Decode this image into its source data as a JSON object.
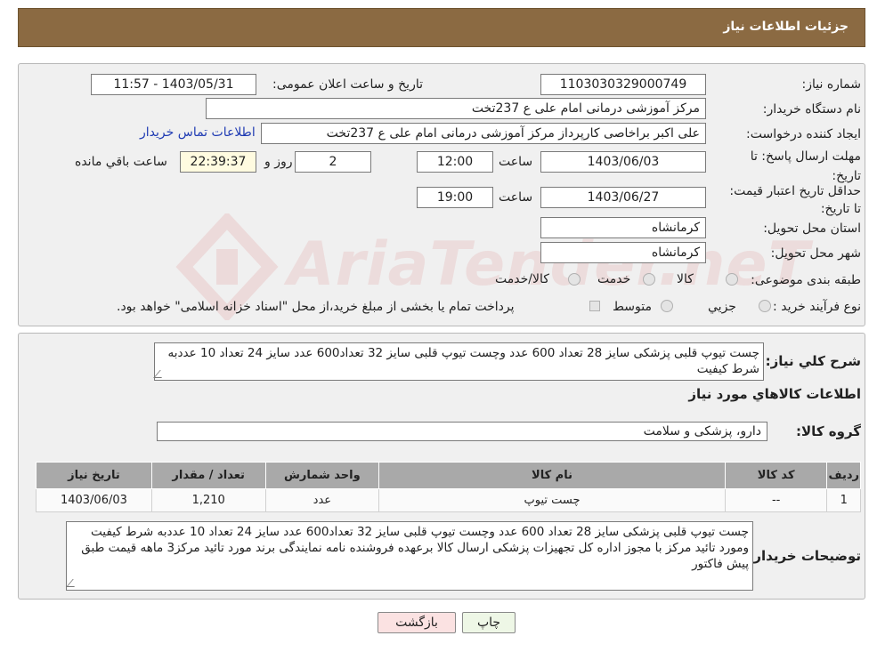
{
  "header": {
    "title": "جزئیات اطلاعات نیاز"
  },
  "form": {
    "need_number_label": "شماره نیاز:",
    "need_number": "1103030329000749",
    "announce_datetime_label": "تاریخ و ساعت اعلان عمومی:",
    "announce_datetime": "1403/05/31 - 11:57",
    "buyer_org_label": "نام دستگاه خریدار:",
    "buyer_org": "مرکز آموزشی درمانی امام علی ع 237تخت",
    "requester_label": "ایجاد کننده درخواست:",
    "requester": "علی اکبر براخاصی کارپرداز  مرکز آموزشی درمانی امام علی ع 237تخت",
    "contact_link": "اطلاعات تماس خریدار",
    "reply_deadline_label": "مهلت ارسال پاسخ: تا تاریخ:",
    "reply_deadline_date": "1403/06/03",
    "time_label": "ساعت",
    "reply_deadline_time": "12:00",
    "days_count": "2",
    "days_label": "روز و",
    "remaining_time": "22:39:37",
    "remaining_label": "ساعت باقي مانده",
    "price_validity_label": "حداقل تاریخ اعتبار قیمت: تا تاریخ:",
    "price_validity_date": "1403/06/27",
    "price_validity_time": "19:00",
    "province_label": "استان محل تحویل:",
    "province": "کرمانشاه",
    "city_label": "شهر محل تحویل:",
    "city": "کرمانشاه",
    "category_label": "طبقه بندی موضوعی:",
    "category_options": [
      "کالا",
      "خدمت",
      "کالا/خدمت"
    ],
    "purchase_type_label": "نوع فرآیند خرید :",
    "purchase_options": [
      "جزیي",
      "متوسط"
    ],
    "payment_note": "پرداخت تمام یا بخشی از مبلغ خرید،از محل \"اسناد خزانه اسلامی\" خواهد بود."
  },
  "summary": {
    "label": "شرح كلي نياز:",
    "text": "چست تیوپ  قلبی پزشکی سایز 28  تعداد 600 عدد وچست تیوپ  قلبی سایز 32 تعداد600 عدد سایز  24 تعداد 10 عددبه شرط کیفیت",
    "items_title": "اطلاعات كالاهاي مورد نياز",
    "group_label": "گروه کالا:",
    "group_value": "دارو، پزشکی و سلامت"
  },
  "table": {
    "columns": [
      "رديف",
      "کد کالا",
      "نام کالا",
      "واحد شمارش",
      "تعداد / مقدار",
      "تاریخ نیاز"
    ],
    "rows": [
      [
        "1",
        "--",
        "چست تیوپ",
        "عدد",
        "1,210",
        "1403/06/03"
      ]
    ]
  },
  "buyer_notes": {
    "label": "توضیحات خریدار:",
    "text": "چست تیوپ  قلبی پزشکی سایز 28  تعداد 600 عدد وچست تیوپ  قلبی سایز 32 تعداد600 عدد سایز  24 تعداد 10 عددبه شرط کیفیت ومورد تائید مرکز با مجوز اداره کل تجهیزات پزشکی ارسال کالا برعهده فروشنده نامه نمایندگی برند مورد تائید مرکز3 ماهه قیمت طبق پیش فاکتور"
  },
  "buttons": {
    "print": "چاپ",
    "back": "بازگشت"
  },
  "watermark": {
    "text": "AriaTender.neT"
  },
  "colors": {
    "header": "#8b6a42",
    "back_button": "#fbe2e2",
    "print_button": "#eef7e6",
    "link": "#1f3bb3"
  }
}
